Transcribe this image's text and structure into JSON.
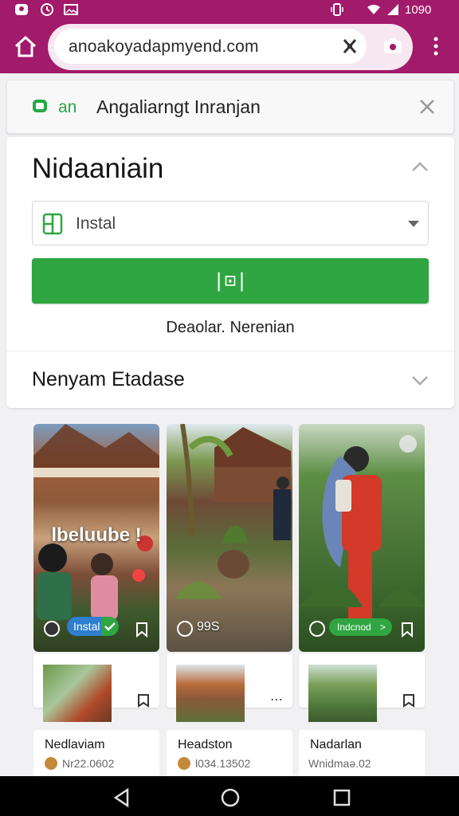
{
  "status_bar": {
    "time": "1090",
    "icons": [
      "app-notification-icon",
      "clock-icon",
      "image-icon",
      "vibrate-icon",
      "wifi-icon",
      "signal-icon"
    ]
  },
  "browser": {
    "url": "anoakoyadapmyend.com",
    "icons": [
      "home-icon",
      "tool-icon",
      "camera-icon",
      "more-icon"
    ],
    "accent": "#a21a6a"
  },
  "banner": {
    "tag": "an",
    "title": "Angaliarngt Inranjan"
  },
  "panel": {
    "title": "Nidaaniain",
    "select_value": "Instal",
    "button_glyph": "|⊡|",
    "link_text": "Deaolar. Nerenian",
    "section_title": "Nenyam Etadase",
    "accent_green": "#2fa641"
  },
  "gallery": [
    {
      "overlay_text": "lbeluube !",
      "badge": "Instal",
      "count": ""
    },
    {
      "overlay_text": "",
      "badge": "",
      "count": "99S"
    },
    {
      "overlay_text": "",
      "badge": "Indcnod",
      "count": ""
    }
  ],
  "items": [
    {
      "name": "Nedlaviam",
      "code": "Nr22.0602"
    },
    {
      "name": "Headston",
      "code": "l034.13502"
    },
    {
      "name": "Nadarlan",
      "code": "Wnidmaə.02"
    }
  ],
  "navbar": {
    "buttons": [
      "back-icon",
      "home-circle-icon",
      "recents-icon"
    ]
  }
}
